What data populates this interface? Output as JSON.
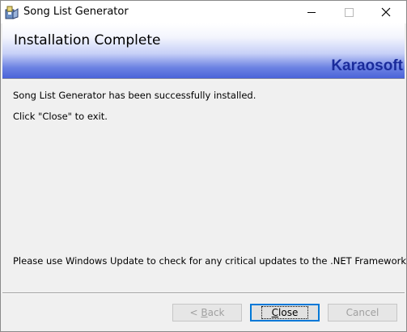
{
  "window": {
    "title": "Song List Generator"
  },
  "banner": {
    "title": "Installation Complete",
    "brand": "Karaosoft",
    "gradient_colors": [
      "#ffffff",
      "#c7d0f7",
      "#4a63d8"
    ],
    "brand_color": "#1a2b9b"
  },
  "messages": {
    "installed": "Song List Generator has been successfully installed.",
    "exit_hint": "Click \"Close\" to exit.",
    "update_note": "Please use Windows Update to check for any critical updates to the .NET Framework."
  },
  "buttons": {
    "back_prefix": "< ",
    "back_mnemonic": "B",
    "back_rest": "ack",
    "close_mnemonic": "C",
    "close_rest": "lose",
    "cancel": "Cancel"
  },
  "icons": {
    "app": "installer-icon",
    "minimize": "minimize-icon",
    "maximize": "maximize-icon",
    "close": "close-icon"
  },
  "accent_color": "#0078d7"
}
